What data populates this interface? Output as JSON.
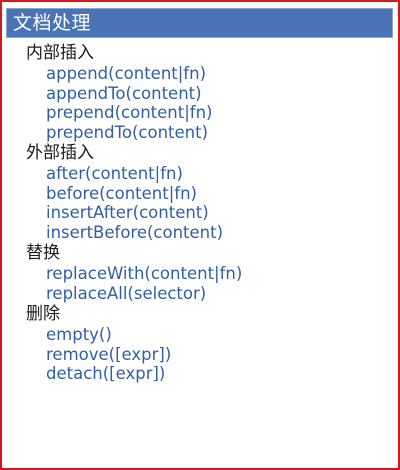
{
  "panel": {
    "title": "文档处理"
  },
  "sections": [
    {
      "heading": "内部插入",
      "items": [
        "append(content|fn)",
        "appendTo(content)",
        "prepend(content|fn)",
        "prependTo(content)"
      ]
    },
    {
      "heading": "外部插入",
      "items": [
        "after(content|fn)",
        "before(content|fn)",
        "insertAfter(content)",
        "insertBefore(content)"
      ]
    },
    {
      "heading": "替换",
      "items": [
        "replaceWith(content|fn)",
        "replaceAll(selector)"
      ]
    },
    {
      "heading": "删除",
      "items": [
        "empty()",
        "remove([expr])",
        "detach([expr])"
      ]
    }
  ],
  "colors": {
    "title_bar": "#4a74b5",
    "border": "#d31a1a",
    "link": "#2f5fa6",
    "heading": "#1a1a1a"
  }
}
